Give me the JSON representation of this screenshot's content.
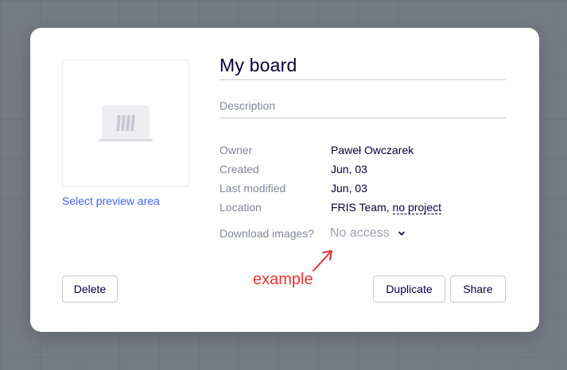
{
  "board": {
    "title": "My board",
    "description_placeholder": "Description",
    "select_preview_label": "Select preview area"
  },
  "info": [
    {
      "key": "Owner",
      "value": "Paweł Owczarek"
    },
    {
      "key": "Created",
      "value": "Jun, 03"
    },
    {
      "key": "Last modified",
      "value": "Jun, 03"
    }
  ],
  "location": {
    "key": "Location",
    "team": "FRIS Team,",
    "project": "no project"
  },
  "download": {
    "label": "Download images?",
    "selected": "No access"
  },
  "annotation": {
    "text": "example",
    "color": "#e8302f"
  },
  "buttons": {
    "delete": "Delete",
    "duplicate": "Duplicate",
    "share": "Share"
  },
  "colors": {
    "accent": "#4262ff",
    "text": "#050038",
    "muted": "#858599"
  },
  "icons": {
    "preview": "board-placeholder-icon",
    "dropdown": "chevron-down-icon"
  }
}
